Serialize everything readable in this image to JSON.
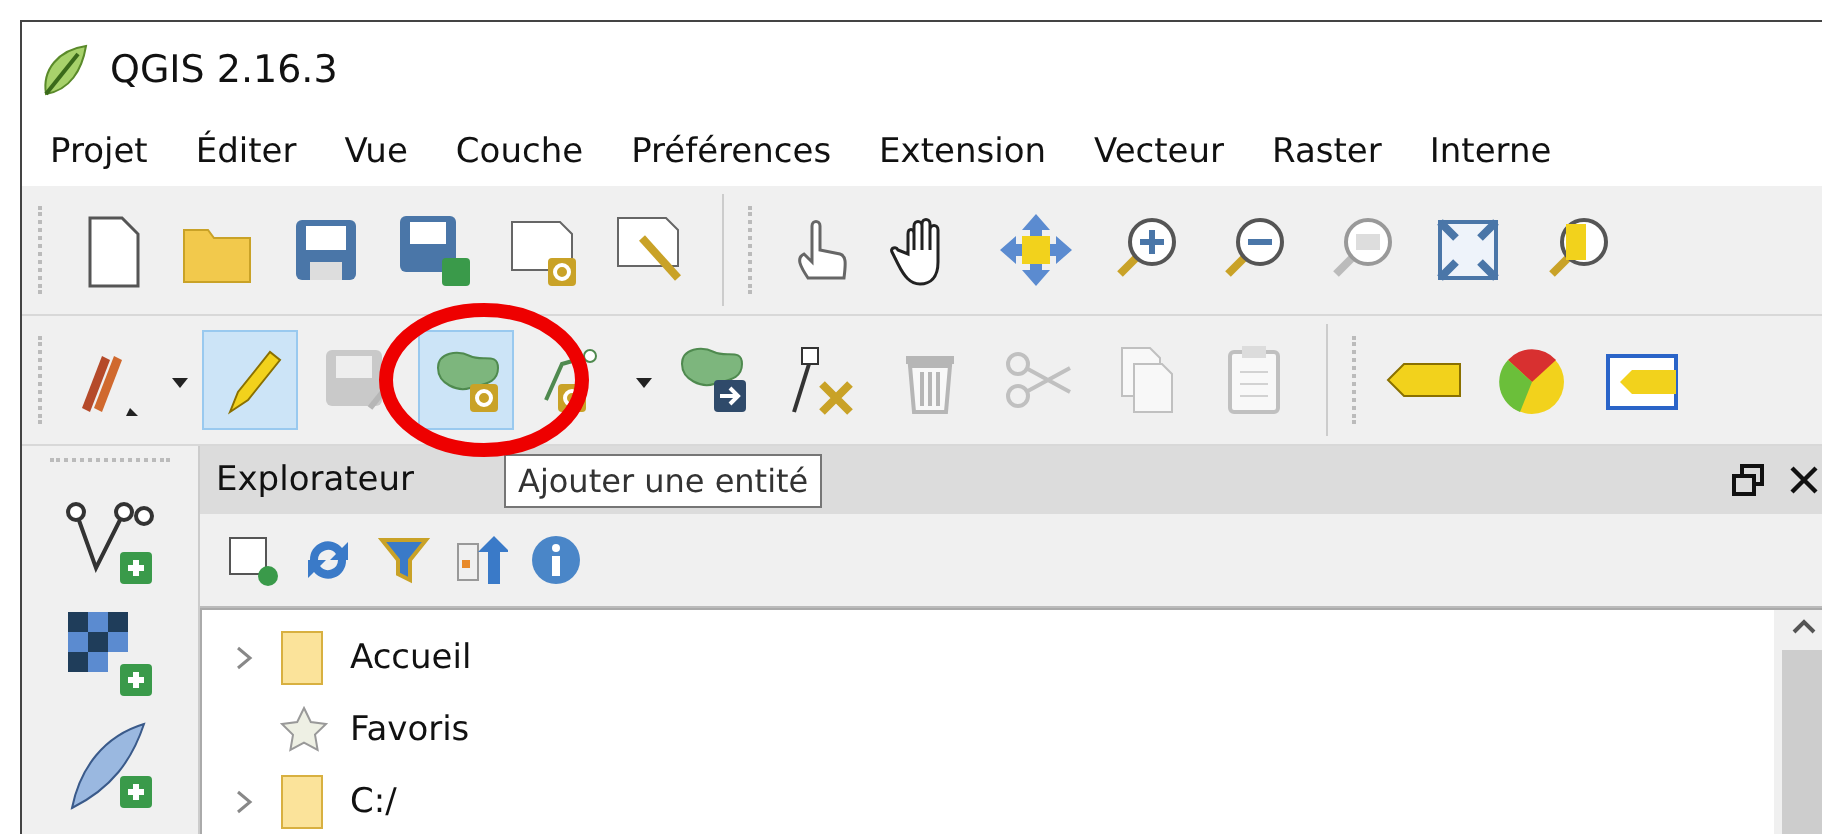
{
  "window": {
    "title": "QGIS 2.16.3"
  },
  "menu": [
    "Projet",
    "Éditer",
    "Vue",
    "Couche",
    "Préférences",
    "Extension",
    "Vecteur",
    "Raster",
    "Interne"
  ],
  "digitizing_toolbar": [
    {
      "on": false,
      "disabled": false
    },
    {
      "on": true,
      "disabled": false
    },
    {
      "on": false,
      "disabled": true
    },
    {
      "on": true,
      "disabled": false
    },
    {
      "on": false,
      "disabled": false
    },
    {
      "on": false,
      "disabled": false
    },
    {
      "on": false,
      "disabled": false
    },
    {
      "on": false,
      "disabled": true
    },
    {
      "on": false,
      "disabled": true
    },
    {
      "on": false,
      "disabled": true
    },
    {
      "on": false,
      "disabled": true
    }
  ],
  "tooltip": {
    "text": "Ajouter une entité"
  },
  "browser_panel": {
    "title": "Explorateur",
    "tree": [
      {
        "kind": "folder",
        "label": "Accueil",
        "expanded": false
      },
      {
        "kind": "favorites",
        "label": "Favoris"
      },
      {
        "kind": "folder",
        "label": "C:/",
        "expanded": false
      }
    ]
  }
}
